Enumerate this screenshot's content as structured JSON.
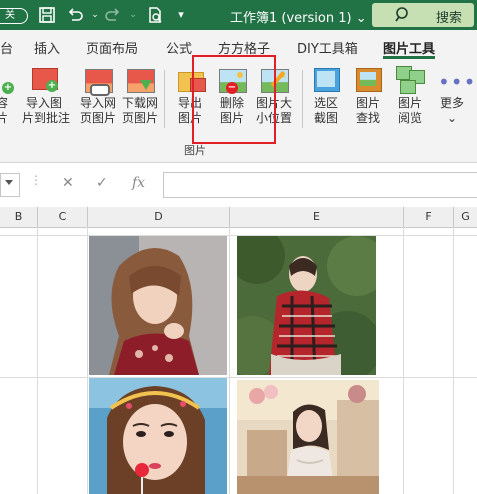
{
  "titlebar": {
    "autosave_label": "关",
    "title": "工作簿1 (version 1) ⌄",
    "search_label": "搜索"
  },
  "tabs": [
    "台",
    "插入",
    "页面布局",
    "公式",
    "方方格子",
    "DIY工具箱",
    "图片工具"
  ],
  "active_tab": "图片工具",
  "ribbon": {
    "buttons": [
      {
        "label": "容\n片"
      },
      {
        "label": "导入图\n片到批注"
      },
      {
        "label": "导入网\n页图片"
      },
      {
        "label": "下载网\n页图片"
      },
      {
        "label": "导出\n图片"
      },
      {
        "label": "删除\n图片"
      },
      {
        "label": "图片大\n小位置"
      },
      {
        "label": "选区\n截图"
      },
      {
        "label": "图片\n查找"
      },
      {
        "label": "图片\n阅览"
      },
      {
        "label": "更多\n⌄"
      }
    ],
    "group_label": "图片"
  },
  "formula_bar": {
    "cancel": "✕",
    "enter": "✓",
    "fx": "fx",
    "value": ""
  },
  "columns": [
    "B",
    "C",
    "D",
    "E",
    "F",
    "G"
  ],
  "colors": {
    "titlebar": "#217346",
    "highlight": "#e21f26",
    "ribbon_bg": "#f3f3f3"
  }
}
